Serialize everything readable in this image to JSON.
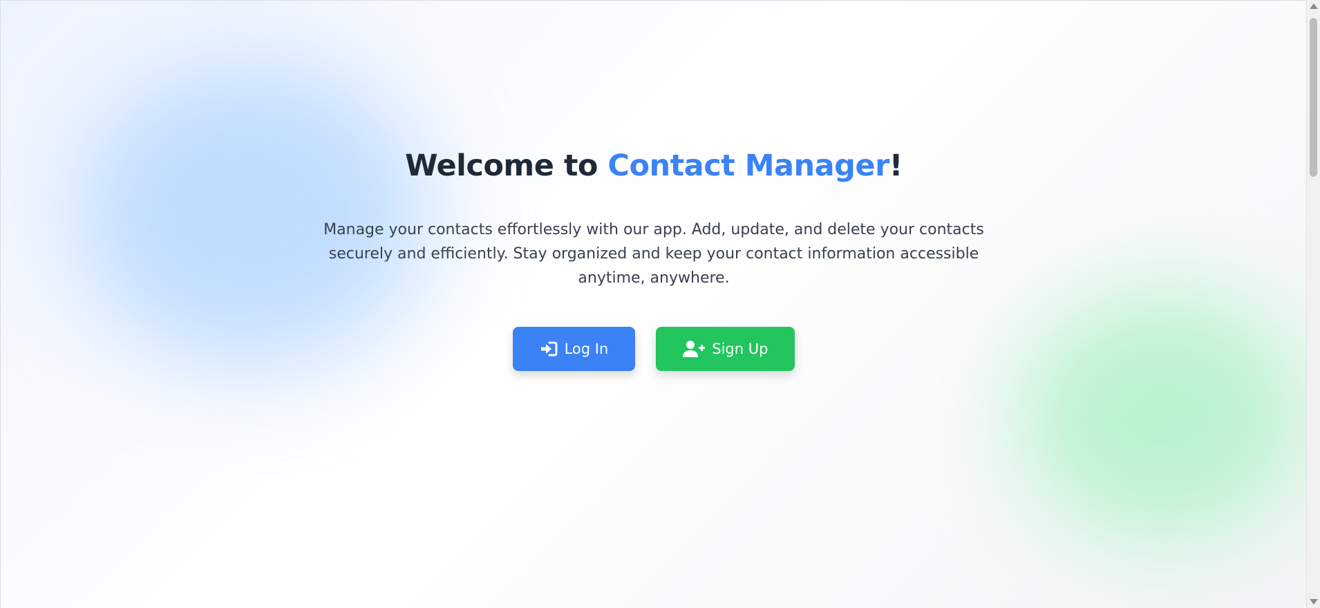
{
  "hero": {
    "title_prefix": "Welcome to ",
    "title_brand": "Contact Manager",
    "title_suffix": "!",
    "description": "Manage your contacts effortlessly with our app. Add, update, and delete your contacts securely and efficiently. Stay organized and keep your contact information accessible anytime, anywhere."
  },
  "actions": {
    "login_label": "Log In",
    "login_icon": "login-icon",
    "signup_label": "Sign Up",
    "signup_icon": "user-plus-icon"
  },
  "colors": {
    "brand": "#3b82f6",
    "login_button": "#3b82f6",
    "signup_button": "#22c55e",
    "title_text": "#1f2937",
    "body_text": "#374151"
  }
}
